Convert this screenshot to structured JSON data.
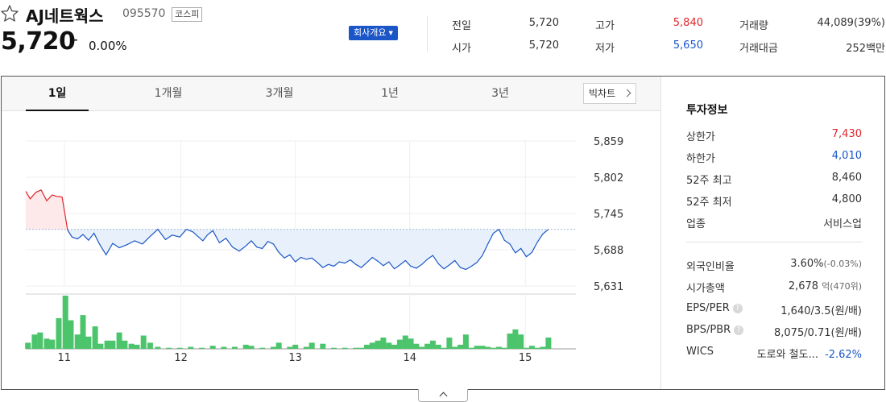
{
  "header": {
    "stock_name": "AJ네트웍스",
    "stock_code": "095570",
    "market": "코스피",
    "price": "5,720",
    "change_symbol": "–",
    "change_rate": "0.00%",
    "company_button": "회사개요"
  },
  "quotes": {
    "prev_close_label": "전일",
    "prev_close": "5,720",
    "open_label": "시가",
    "open": "5,720",
    "high_label": "고가",
    "high": "5,840",
    "low_label": "저가",
    "low": "5,650",
    "volume_label": "거래량",
    "volume": "44,089(39%)",
    "amount_label": "거래대금",
    "amount": "252백만"
  },
  "tabs": [
    "1일",
    "1개월",
    "3개월",
    "1년",
    "3년"
  ],
  "active_tab": "1일",
  "big_chart_label": "빅차트",
  "chart_data": {
    "type": "line",
    "y_ticks": [
      5859,
      5802,
      5745,
      5688,
      5631
    ],
    "y_tick_labels": [
      "5,859",
      "5,802",
      "5,745",
      "5,688",
      "5,631"
    ],
    "ylim": [
      5631,
      5859
    ],
    "x_ticks": [
      "11",
      "12",
      "13",
      "14",
      "15"
    ],
    "x_tick_positions": [
      1.35,
      2.41,
      3.45,
      4.49,
      5.54
    ],
    "xlim": [
      1.0,
      6.0
    ],
    "baseline": 5720,
    "price_series": {
      "x": [
        1.0,
        1.04,
        1.09,
        1.14,
        1.19,
        1.24,
        1.28,
        1.33,
        1.38,
        1.42,
        1.47,
        1.52,
        1.57,
        1.62,
        1.67,
        1.73,
        1.79,
        1.85,
        1.92,
        1.99,
        2.06,
        2.13,
        2.2,
        2.27,
        2.33,
        2.4,
        2.46,
        2.52,
        2.57,
        2.61,
        2.65,
        2.7,
        2.76,
        2.82,
        2.88,
        2.94,
        3.0,
        3.05,
        3.1,
        3.15,
        3.2,
        3.25,
        3.3,
        3.35,
        3.4,
        3.45,
        3.5,
        3.55,
        3.6,
        3.65,
        3.7,
        3.75,
        3.8,
        3.85,
        3.9,
        3.95,
        4.0,
        4.05,
        4.1,
        4.15,
        4.2,
        4.25,
        4.3,
        4.35,
        4.4,
        4.45,
        4.5,
        4.55,
        4.6,
        4.65,
        4.7,
        4.75,
        4.8,
        4.85,
        4.9,
        4.95,
        5.0,
        5.05,
        5.1,
        5.15,
        5.2,
        5.25,
        5.3,
        5.35,
        5.4,
        5.45,
        5.5,
        5.55,
        5.6,
        5.65,
        5.7,
        5.75
      ],
      "values": [
        5780,
        5768,
        5778,
        5782,
        5765,
        5774,
        5772,
        5771,
        5719,
        5708,
        5705,
        5712,
        5703,
        5714,
        5697,
        5680,
        5698,
        5691,
        5696,
        5702,
        5697,
        5709,
        5720,
        5704,
        5711,
        5708,
        5720,
        5716,
        5708,
        5702,
        5711,
        5718,
        5699,
        5706,
        5692,
        5686,
        5694,
        5702,
        5692,
        5690,
        5701,
        5697,
        5684,
        5675,
        5680,
        5669,
        5676,
        5673,
        5675,
        5668,
        5660,
        5665,
        5662,
        5669,
        5667,
        5672,
        5665,
        5660,
        5668,
        5676,
        5670,
        5663,
        5669,
        5658,
        5664,
        5671,
        5662,
        5659,
        5665,
        5673,
        5679,
        5666,
        5658,
        5664,
        5671,
        5660,
        5657,
        5662,
        5668,
        5679,
        5697,
        5714,
        5720,
        5703,
        5697,
        5683,
        5690,
        5677,
        5684,
        5700,
        5713,
        5720
      ]
    },
    "volume_series": {
      "x": [
        1.02,
        1.08,
        1.13,
        1.19,
        1.24,
        1.3,
        1.36,
        1.41,
        1.47,
        1.52,
        1.57,
        1.63,
        1.68,
        1.74,
        1.79,
        1.85,
        1.9,
        1.96,
        2.01,
        2.07,
        2.13,
        2.2,
        2.3,
        2.4,
        2.5,
        2.6,
        2.7,
        2.8,
        2.9,
        3.0,
        3.05,
        3.15,
        3.25,
        3.3,
        3.4,
        3.45,
        3.55,
        3.6,
        3.7,
        3.8,
        3.9,
        4.0,
        4.05,
        4.1,
        4.15,
        4.2,
        4.25,
        4.3,
        4.35,
        4.4,
        4.45,
        4.5,
        4.55,
        4.6,
        4.65,
        4.7,
        4.75,
        4.8,
        4.85,
        4.9,
        4.95,
        5.0,
        5.05,
        5.1,
        5.15,
        5.2,
        5.25,
        5.3,
        5.35,
        5.4,
        5.45,
        5.5,
        5.55,
        5.6,
        5.65,
        5.7,
        5.75
      ],
      "values": [
        6,
        14,
        16,
        10,
        9,
        30,
        52,
        28,
        14,
        33,
        12,
        22,
        5,
        8,
        8,
        16,
        8,
        5,
        4,
        13,
        6,
        2,
        1,
        1,
        2,
        1,
        3,
        2,
        2,
        4,
        3,
        1,
        2,
        6,
        2,
        4,
        2,
        6,
        5,
        1,
        1,
        1,
        1,
        4,
        6,
        8,
        11,
        6,
        4,
        9,
        13,
        10,
        5,
        2,
        5,
        8,
        4,
        1,
        11,
        2,
        4,
        14,
        1,
        3,
        3,
        2,
        1,
        2,
        1,
        15,
        19,
        14,
        1,
        3,
        1,
        2,
        11
      ]
    }
  },
  "invest": {
    "title": "투자정보",
    "upper_limit_label": "상한가",
    "upper_limit": "7,430",
    "lower_limit_label": "하한가",
    "lower_limit": "4,010",
    "w52_high_label": "52주 최고",
    "w52_high": "8,460",
    "w52_low_label": "52주 최저",
    "w52_low": "4,800",
    "sector_label": "업종",
    "sector": "서비스업",
    "foreign_label": "외국인비율",
    "foreign": "3.60%",
    "foreign_change": "(-0.03%)",
    "mcap_label": "시가총액",
    "mcap": "2,678",
    "mcap_unit": "억",
    "mcap_rank": "(470위)",
    "eps_per_label": "EPS/PER",
    "eps_per": "1,640/3.5",
    "eps_per_unit": "(원/배)",
    "bps_pbr_label": "BPS/PBR",
    "bps_pbr": "8,075/0.71",
    "bps_pbr_unit": "(원/배)",
    "wics_label": "WICS",
    "wics": "도로와 철도...",
    "wics_change": "-2.62%"
  },
  "colors": {
    "up": "#e0272b",
    "down": "#1a56c8",
    "volume": "#4cc46c",
    "accent": "#1a56c8"
  }
}
